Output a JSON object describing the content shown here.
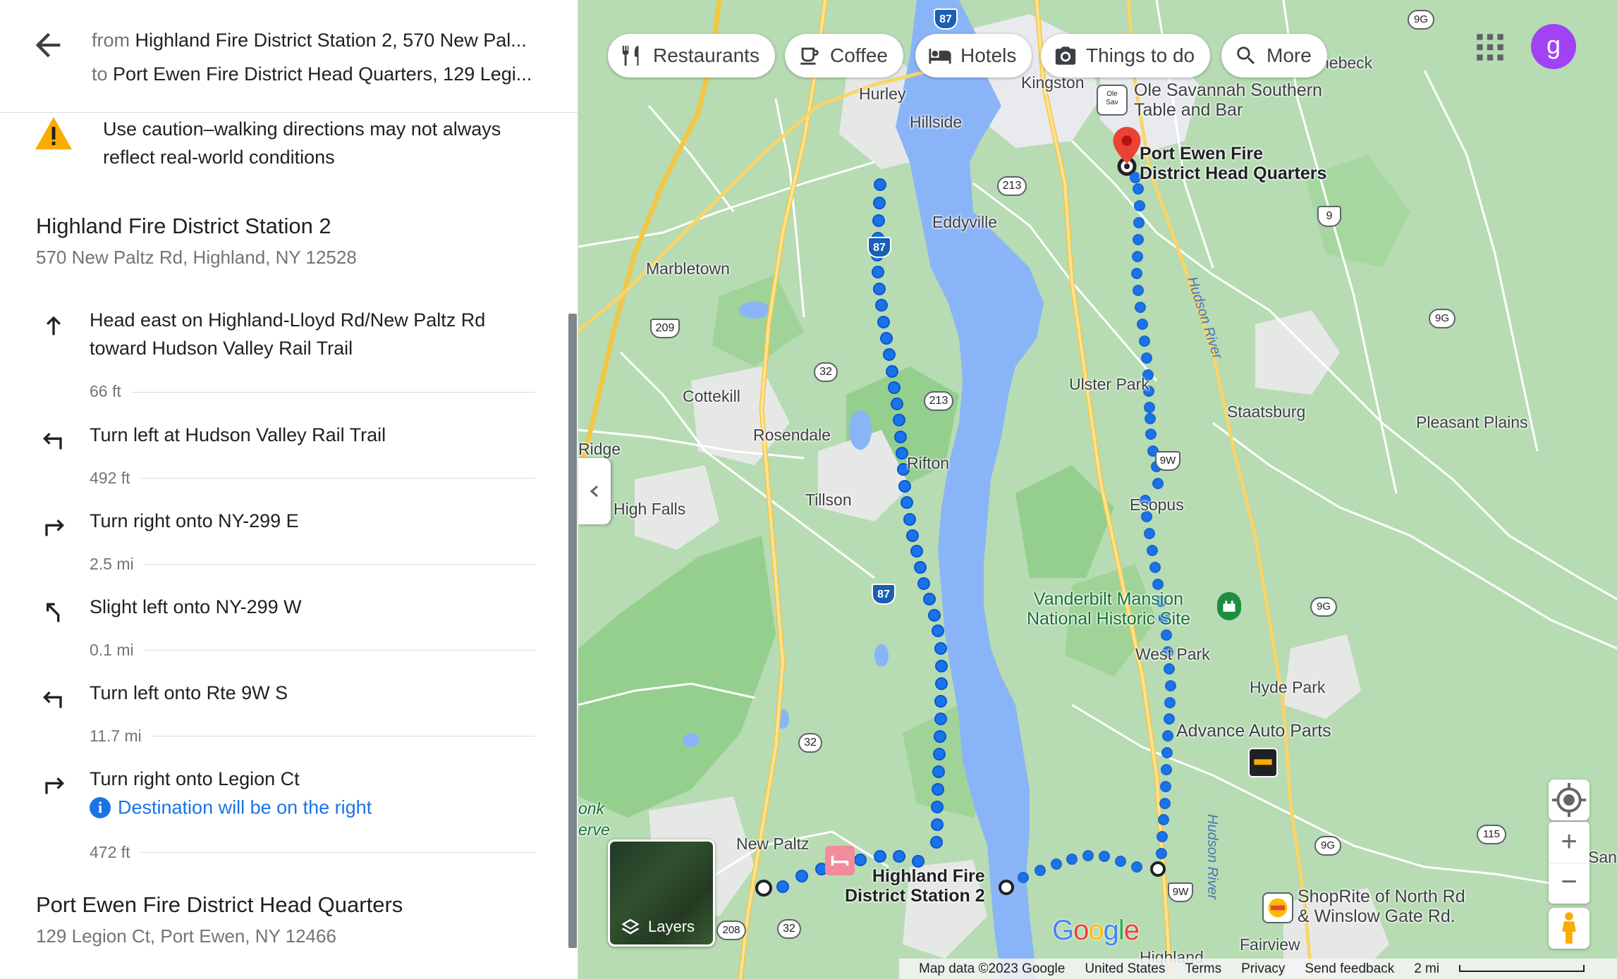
{
  "route": {
    "from_prefix": "from",
    "from_value": "Highland Fire District Station 2, 570 New Pal...",
    "to_prefix": "to",
    "to_value": "Port Ewen Fire District Head Quarters, 129 Legi..."
  },
  "warning": "Use caution–walking directions may not always reflect real-world conditions",
  "origin": {
    "name": "Highland Fire District Station 2",
    "address": "570 New Paltz Rd, Highland, NY 12528"
  },
  "steps": [
    {
      "icon": "straight-arrow-icon",
      "text": "Head east on Highland-Lloyd Rd/New Paltz Rd toward Hudson Valley Rail Trail",
      "distance": "66 ft"
    },
    {
      "icon": "turn-left-icon",
      "text": "Turn left at Hudson Valley Rail Trail",
      "distance": "492 ft"
    },
    {
      "icon": "turn-right-icon",
      "text": "Turn right onto NY-299 E",
      "distance": "2.5 mi"
    },
    {
      "icon": "slight-left-icon",
      "text": "Slight left onto NY-299 W",
      "distance": "0.1 mi"
    },
    {
      "icon": "turn-left-icon",
      "text": "Turn left onto Rte 9W S",
      "distance": "11.7 mi"
    },
    {
      "icon": "turn-right-icon",
      "text": "Turn right onto Legion Ct",
      "note": "Destination will be on the right",
      "distance": "472 ft"
    }
  ],
  "destination": {
    "name": "Port Ewen Fire District Head Quarters",
    "address": "129 Legion Ct, Port Ewen, NY 12466"
  },
  "chips": [
    {
      "label": "Restaurants",
      "icon": "fork-knife-icon"
    },
    {
      "label": "Coffee",
      "icon": "coffee-icon"
    },
    {
      "label": "Hotels",
      "icon": "bed-icon"
    },
    {
      "label": "Things to do",
      "icon": "camera-icon"
    },
    {
      "label": "More",
      "icon": "search-icon"
    }
  ],
  "avatar_letter": "g",
  "map_labels": {
    "kingston": "Kingston",
    "hurley": "Hurley",
    "hillside": "Hillside",
    "eddyville": "Eddyville",
    "marbletown": "Marbletown",
    "cottekill": "Cottekill",
    "rosendale": "Rosendale",
    "rifton": "Rifton",
    "tillson": "Tillson",
    "high_falls": "High Falls",
    "ridge": "Ridge",
    "ulster_park": "Ulster Park",
    "staatsburg": "Staatsburg",
    "pleasant_plains": "Pleasant Plains",
    "esopus": "Esopus",
    "west_park": "West Park",
    "hyde_park": "Hyde Park",
    "new_paltz": "New Paltz",
    "fairview": "Fairview",
    "highland": "Highland",
    "rhinebeck": "hebeck",
    "san": "San",
    "mohonk": "onk",
    "preserve": "erve",
    "hudson_river_1": "Hudson River",
    "hudson_river_2": "Hudson River",
    "ole_savannah": "Ole Savannah Southern\nTable and Bar",
    "port_ewen": "Port Ewen Fire\nDistrict Head Quarters",
    "highland_fire": "Highland Fire\nDistrict Station 2",
    "vanderbilt": "Vanderbilt Mansion\nNational Historic Site",
    "advance_auto": "Advance Auto Parts",
    "shoprite": "ShopRite of North Rd\n& Winslow Gate Rd."
  },
  "shields": {
    "i87_a": "87",
    "i87_b": "87",
    "i87_c": "87",
    "r213_a": "213",
    "r213_b": "213",
    "r209": "209",
    "r32_a": "32",
    "r32_b": "32",
    "r32_c": "32",
    "r9_a": "9",
    "r9w_a": "9W",
    "r9w_b": "9W",
    "r9g_a": "9G",
    "r9g_b": "9G",
    "r9g_c": "9G",
    "r9g_d": "9G",
    "r9g_e": "9G",
    "r115": "115",
    "r208": "208"
  },
  "layers_label": "Layers",
  "google_logo": [
    "G",
    "o",
    "o",
    "g",
    "l",
    "e"
  ],
  "footer": {
    "map_data": "Map data ©2023 Google",
    "country": "United States",
    "terms": "Terms",
    "privacy": "Privacy",
    "feedback": "Send feedback",
    "scale": "2 mi"
  },
  "colors": {
    "route_blue": "#1a73e8",
    "water": "#8ab4f8",
    "land": "#b7dbb3",
    "urban": "#e8eaed",
    "highway": "#fdd663",
    "pin_red": "#ea4335",
    "avatar": "#a142f4"
  }
}
